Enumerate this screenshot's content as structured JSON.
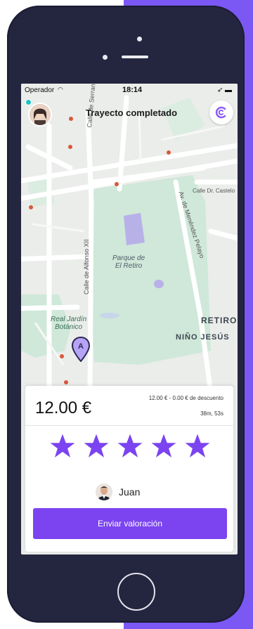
{
  "status_bar": {
    "carrier": "Operador",
    "time": "18:14",
    "indicators": "➶ ▬"
  },
  "header": {
    "title": "Trayecto completado"
  },
  "map": {
    "streets": [
      "Calle de Serrano",
      "Calle de Alfonso XII",
      "Calle Dr. Castelo",
      "Av. de Menéndez Pelayo"
    ],
    "park": "Parque de\nEl Retiro",
    "garden": "Real Jardín\nBotánico",
    "districts": [
      "RETIRO",
      "NIÑO JESÚS"
    ],
    "pin_label": "A"
  },
  "fare": {
    "amount": "12.00 €",
    "detail": "12.00 € - 0.00 € de descuento",
    "duration": "38m, 53s"
  },
  "rating": {
    "stars": 5,
    "max_stars": 5,
    "star_color": "#7b44f0"
  },
  "driver": {
    "name": "Juan"
  },
  "submit": {
    "label": "Enviar valoración"
  },
  "colors": {
    "accent": "#7b57f4",
    "button": "#7b44f0",
    "phone_body": "#24253f"
  }
}
